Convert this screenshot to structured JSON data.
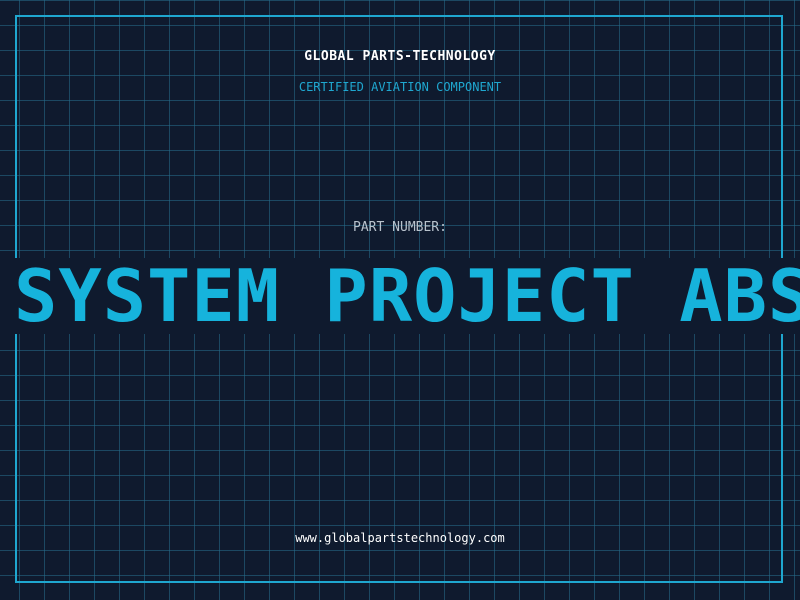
{
  "header": {
    "company": "GLOBAL PARTS-TECHNOLOGY",
    "certification": "CERTIFIED AVIATION COMPONENT"
  },
  "part": {
    "label": "PART NUMBER:",
    "number": "SYSTEM PROJECT ABS"
  },
  "footer": {
    "website": "www.globalpartstechnology.com"
  },
  "colors": {
    "background": "#0f1a2e",
    "accent": "#1fa7d0",
    "part_number": "#16b3dc",
    "grid": "#266e8c"
  }
}
